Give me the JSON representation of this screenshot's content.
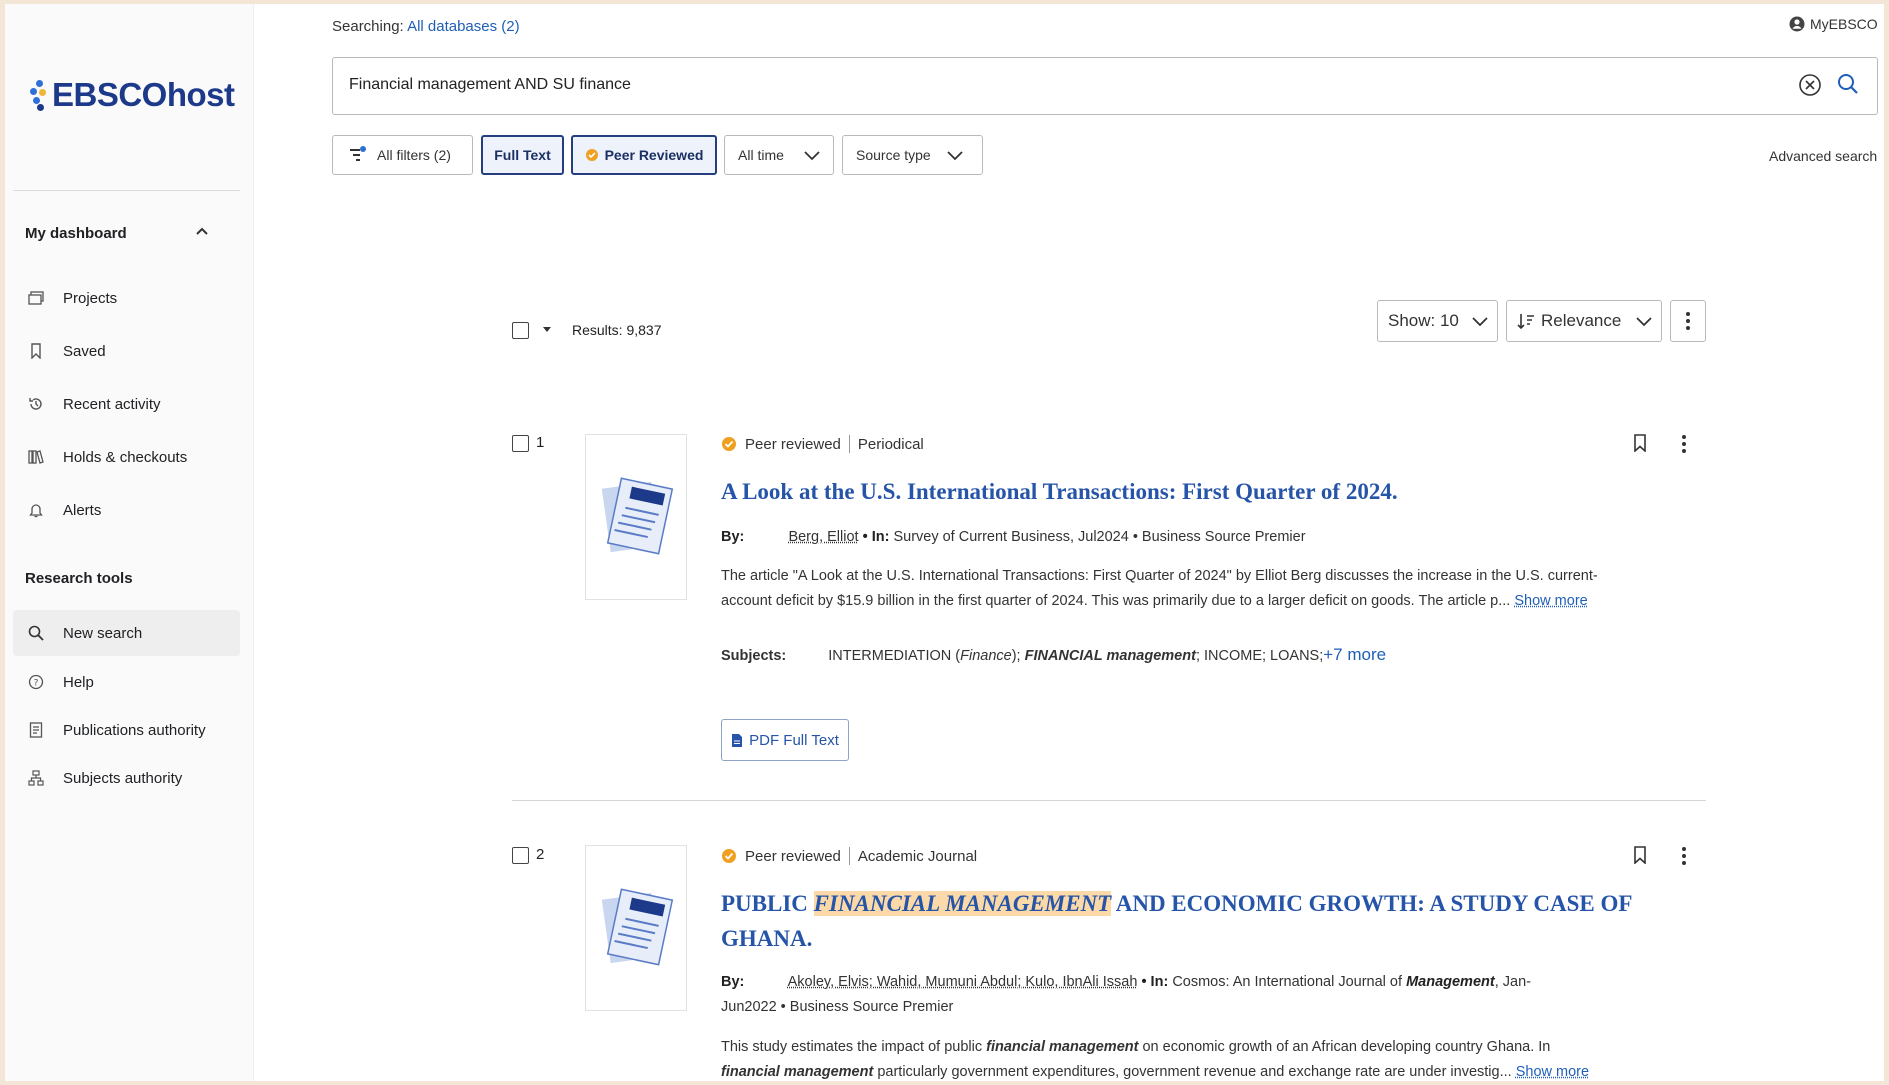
{
  "header": {
    "searching_label": "Searching:",
    "databases_link": "All databases (2)",
    "account": "MyEBSCO",
    "query": "Financial management AND SU finance",
    "advanced": "Advanced search"
  },
  "brand": {
    "logo": "EBSCOhost",
    "colors": [
      "#2e6fd8",
      "#f0b43b",
      "#1d3a8a"
    ]
  },
  "filters": {
    "all_filters": "All filters (2)",
    "full_text": "Full Text",
    "peer_reviewed": "Peer Reviewed",
    "time": "All time",
    "source_type": "Source type"
  },
  "sidebar": {
    "dashboard_title": "My dashboard",
    "dashboard_items": [
      {
        "label": "Projects",
        "icon": "folder-icon"
      },
      {
        "label": "Saved",
        "icon": "bookmark-icon"
      },
      {
        "label": "Recent activity",
        "icon": "history-icon"
      },
      {
        "label": "Holds & checkouts",
        "icon": "books-icon"
      },
      {
        "label": "Alerts",
        "icon": "bell-icon"
      }
    ],
    "tools_title": "Research tools",
    "tools_items": [
      {
        "label": "New search",
        "icon": "search-icon"
      },
      {
        "label": "Help",
        "icon": "help-icon"
      },
      {
        "label": "Publications authority",
        "icon": "publication-icon"
      },
      {
        "label": "Subjects authority",
        "icon": "hierarchy-icon"
      }
    ]
  },
  "results_bar": {
    "count": "Results: 9,837",
    "show": "Show: 10",
    "sort": "Relevance"
  },
  "results": [
    {
      "number": "1",
      "peer_label": "Peer reviewed",
      "type": "Periodical",
      "title": "A Look at the U.S. International Transactions: First Quarter of 2024.",
      "by_label": "By:",
      "author": "Berg, Elliot",
      "in_label": "• In:",
      "source": "Survey of Current Business, Jul2024 • Business Source Premier",
      "abstract": "The article \"A Look at the U.S. International Transactions: First Quarter of 2024\" by Elliot Berg discusses the increase in the U.S. current-account deficit by $15.9 billion in the first quarter of 2024. This was primarily due to a larger deficit on goods. The article p...",
      "show_more": "Show more",
      "subjects_label": "Subjects:",
      "subjects_a": "INTERMEDIATION (",
      "subjects_a_em": "Finance",
      "subjects_a_end": ");",
      "subjects_b": "FINANCIAL management",
      "subjects_c": "; INCOME; LOANS;",
      "subjects_more": "+7 more",
      "pdf": "PDF Full Text"
    },
    {
      "number": "2",
      "peer_label": "Peer reviewed",
      "type": "Academic Journal",
      "title_pre": "PUBLIC",
      "title_hl": "FINANCIAL MANAGEMENT",
      "title_post": "AND ECONOMIC GROWTH: A STUDY CASE OF GHANA.",
      "by_label": "By:",
      "authors": "Akoley, Elvis; Wahid, Mumuni Abdul; Kulo, IbnAli Issah",
      "in_label": "• In:",
      "source_pre": "Cosmos: An International Journal of",
      "source_em": "Management",
      "source_post": ", Jan-",
      "source_line2": "Jun2022 • Business Source Premier",
      "abstract_l1_pre": "This study estimates the impact of public",
      "abstract_l1_em": "financial management",
      "abstract_l1_post": "on economic growth of an African developing country Ghana. In",
      "abstract_l2_em": "financial management",
      "abstract_l2_post": "particularly government expenditures, government revenue and exchange rate are under investig...",
      "show_more": "Show more"
    }
  ]
}
